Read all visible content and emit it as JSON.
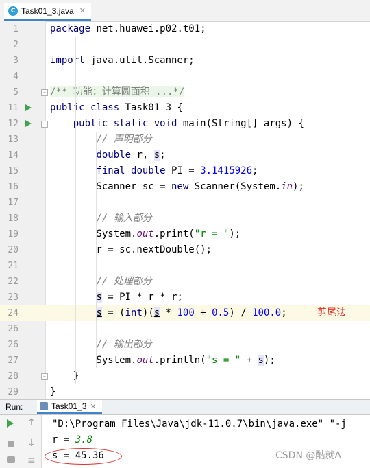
{
  "editor_tab": {
    "label": "Task01_3.java",
    "icon_letter": "C",
    "close": "✕"
  },
  "lines": [
    {
      "n": "1",
      "html": "<span class=\"kw\">package</span> net.huawei.p02.t01;"
    },
    {
      "n": "2",
      "html": ""
    },
    {
      "n": "3",
      "html": "<span class=\"kw\">import</span> java.util.Scanner;"
    },
    {
      "n": "4",
      "html": ""
    },
    {
      "n": "5",
      "html": "<span class=\"doc-bg\"><span class=\"cm\" style=\"font-style:normal\">/** 功能：计算圆面积 ...*/</span></span>",
      "fold": true
    },
    {
      "n": "11",
      "html": "<span class=\"kw\">public class</span> Task01_3 {",
      "run": true
    },
    {
      "n": "12",
      "html": "    <span class=\"kw\">public static void</span> main(String[] args) {",
      "run": true,
      "fold": true
    },
    {
      "n": "13",
      "html": "        <span class=\"cm\">// 声明部分</span>"
    },
    {
      "n": "14",
      "html": "        <span class=\"kw\">double</span> r, <span class=\"s-var uvar\">s</span>;"
    },
    {
      "n": "15",
      "html": "        <span class=\"kw\">final double</span> PI = <span class=\"num\">3.1415926</span>;"
    },
    {
      "n": "16",
      "html": "        Scanner sc = <span class=\"kw\">new</span> Scanner(System.<span class=\"fld\">in</span>);"
    },
    {
      "n": "17",
      "html": ""
    },
    {
      "n": "18",
      "html": "        <span class=\"cm\">// 输入部分</span>"
    },
    {
      "n": "19",
      "html": "        System.<span class=\"fld\">out</span>.print(<span class=\"str\">\"r = \"</span>);"
    },
    {
      "n": "20",
      "html": "        r = sc.nextDouble();"
    },
    {
      "n": "21",
      "html": ""
    },
    {
      "n": "22",
      "html": "        <span class=\"cm\">// 处理部分</span>"
    },
    {
      "n": "23",
      "html": "        <span class=\"s-var uvar\">s</span> = PI * r * r;"
    },
    {
      "n": "24",
      "html": "        <span class=\"s-var uvar\">s</span> = (<span class=\"kw\">int</span>)(<span class=\"s-var uvar\">s</span> * <span class=\"num\">100</span> + <span class=\"num\">0.5</span>) / <span class=\"num\">100.0</span>;",
      "hl": true
    },
    {
      "n": "26",
      "html": ""
    },
    {
      "n": "26",
      "html": "        <span class=\"cm\">// 输出部分</span>"
    },
    {
      "n": "27",
      "html": "        System.<span class=\"fld\">out</span>.println(<span class=\"str\">\"s = \"</span> + <span class=\"s-var uvar\">s</span>);"
    },
    {
      "n": "28",
      "html": "    }",
      "fold": true
    },
    {
      "n": "29",
      "html": "}"
    }
  ],
  "annotation": {
    "label": "剪尾法"
  },
  "run_panel": {
    "label": "Run:",
    "tab_label": "Task01_3",
    "close": "✕"
  },
  "console": {
    "path_line": "\"D:\\Program Files\\Java\\jdk-11.0.7\\bin\\java.exe\" \"-j",
    "input_prefix": "r = ",
    "input_value": "3.8",
    "output_line": "s = 45.36"
  },
  "watermark": "CSDN @酷就A",
  "colors": {
    "keyword": "#000080",
    "number": "#0000ff",
    "string": "#008000",
    "comment": "#808080",
    "annotation": "#e0302e"
  }
}
